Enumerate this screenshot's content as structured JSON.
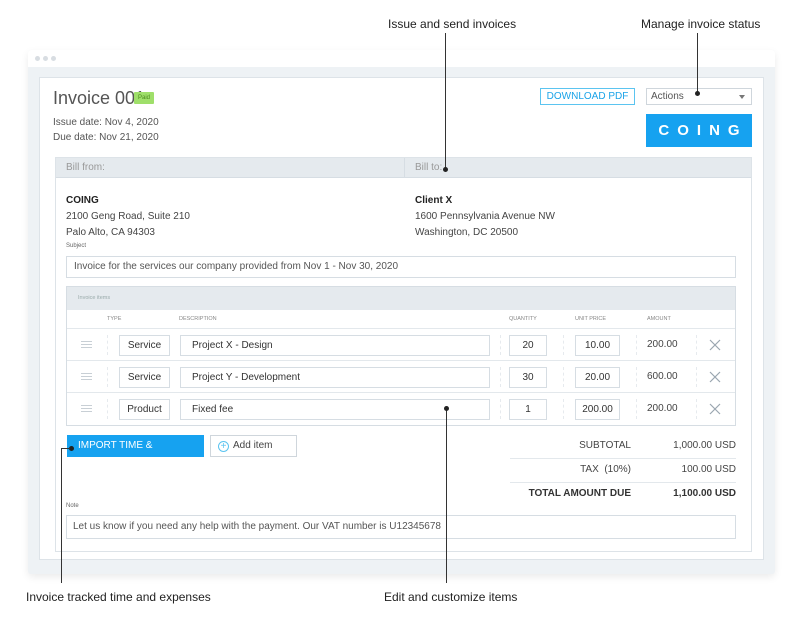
{
  "callouts": {
    "issue_send": "Issue and send invoices",
    "manage_status": "Manage invoice status",
    "import_tracked": "Invoice tracked time and expenses",
    "edit_items": "Edit and customize items"
  },
  "invoice": {
    "title": "Invoice 001",
    "status_badge": "Paid",
    "issue_date": "Issue date: Nov 4, 2020",
    "due_date": "Due date: Nov 21, 2020",
    "download_pdf_label": "DOWNLOAD PDF",
    "actions_label": "Actions",
    "logo_text": "COING"
  },
  "billing": {
    "from_label": "Bill from:",
    "to_label": "Bill to:",
    "from": {
      "name": "COING",
      "line1": "2100 Geng Road, Suite 210",
      "line2": "Palo Alto, CA 94303"
    },
    "to": {
      "name": "Client X",
      "line1": "1600 Pennsylvania Avenue NW",
      "line2": "Washington, DC 20500"
    }
  },
  "subject": {
    "label": "Subject",
    "value": "Invoice for the services our company provided from Nov 1 - Nov 30, 2020"
  },
  "items": {
    "section_label": "Invoice items",
    "columns": {
      "type": "TYPE",
      "description": "DESCRIPTION",
      "quantity": "QUANTITY",
      "unit_price": "UNIT PRICE",
      "amount": "AMOUNT"
    },
    "rows": [
      {
        "type": "Service",
        "description": "Project X - Design",
        "quantity": "20",
        "unit_price": "10.00",
        "amount": "200.00"
      },
      {
        "type": "Service",
        "description": "Project Y - Development",
        "quantity": "30",
        "unit_price": "20.00",
        "amount": "600.00"
      },
      {
        "type": "Product",
        "description": "Fixed fee",
        "quantity": "1",
        "unit_price": "200.00",
        "amount": "200.00"
      }
    ]
  },
  "buttons": {
    "import_label": "IMPORT TIME & EXPENSES",
    "add_item_label": "Add item"
  },
  "totals": {
    "subtotal_label": "SUBTOTAL",
    "subtotal_value": "1,000.00 USD",
    "tax_label": "TAX  (10%)",
    "tax_value": "100.00 USD",
    "total_label": "TOTAL AMOUNT DUE",
    "total_value": "1,100.00 USD"
  },
  "note": {
    "label": "Note",
    "value": "Let us know if you need any help with the payment. Our VAT number is U12345678"
  },
  "colors": {
    "accent": "#16a2f0",
    "paid_badge": "#9fdf6a"
  }
}
